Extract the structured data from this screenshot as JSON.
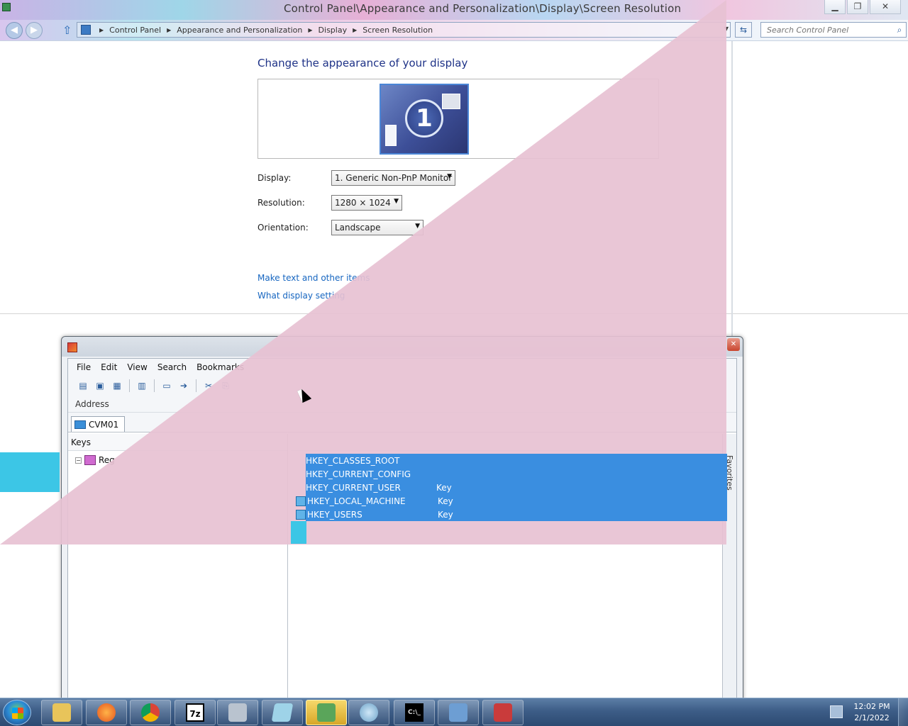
{
  "control_panel": {
    "window_title": "Control Panel\\Appearance and Personalization\\Display\\Screen Resolution",
    "breadcrumb": [
      "Control Panel",
      "Appearance and Personalization",
      "Display",
      "Screen Resolution"
    ],
    "search_placeholder": "Search Control Panel",
    "heading": "Change the appearance of your display",
    "monitor_number": "1",
    "display_label": "Display:",
    "display_value": "1. Generic Non-PnP Monitor",
    "resolution_label": "Resolution:",
    "resolution_value": "1280 × 1024",
    "orientation_label": "Orientation:",
    "orientation_value": "Landscape",
    "link_text_size": "Make text and other items",
    "link_display_settings": "What display setting"
  },
  "registry": {
    "menu": [
      "File",
      "Edit",
      "View",
      "Search",
      "Bookmarks"
    ],
    "address_label": "Address",
    "tab_label": "CVM01",
    "keys_header": "Keys",
    "tree_root": "Reg",
    "favorites_label": "Favorites",
    "rows": [
      {
        "name": "HKEY_CLASSES_ROOT",
        "type": ""
      },
      {
        "name": "HKEY_CURRENT_CONFIG",
        "type": ""
      },
      {
        "name": "HKEY_CURRENT_USER",
        "type": "Key"
      },
      {
        "name": "HKEY_LOCAL_MACHINE",
        "type": "Key"
      },
      {
        "name": "HKEY_USERS",
        "type": "Key"
      }
    ]
  },
  "taskbar": {
    "apps": [
      "file-explorer-icon",
      "firefox-icon",
      "chrome-icon",
      "7zip-icon",
      "archive-icon",
      "notepad-icon",
      "security-icon",
      "installer-icon",
      "cmd-icon",
      "control-panel-icon",
      "registry-icon"
    ],
    "seven_zip_label": "7z",
    "cmd_label": "C:\\_",
    "clock_time": "12:02 PM",
    "clock_date": "2/1/2022"
  },
  "colors": {
    "link": "#1565c0",
    "heading": "#1e3287",
    "selection": "#3a8ee0",
    "glitch_pink": "#e7c1d3",
    "glitch_cyan": "#3cc6e6"
  }
}
